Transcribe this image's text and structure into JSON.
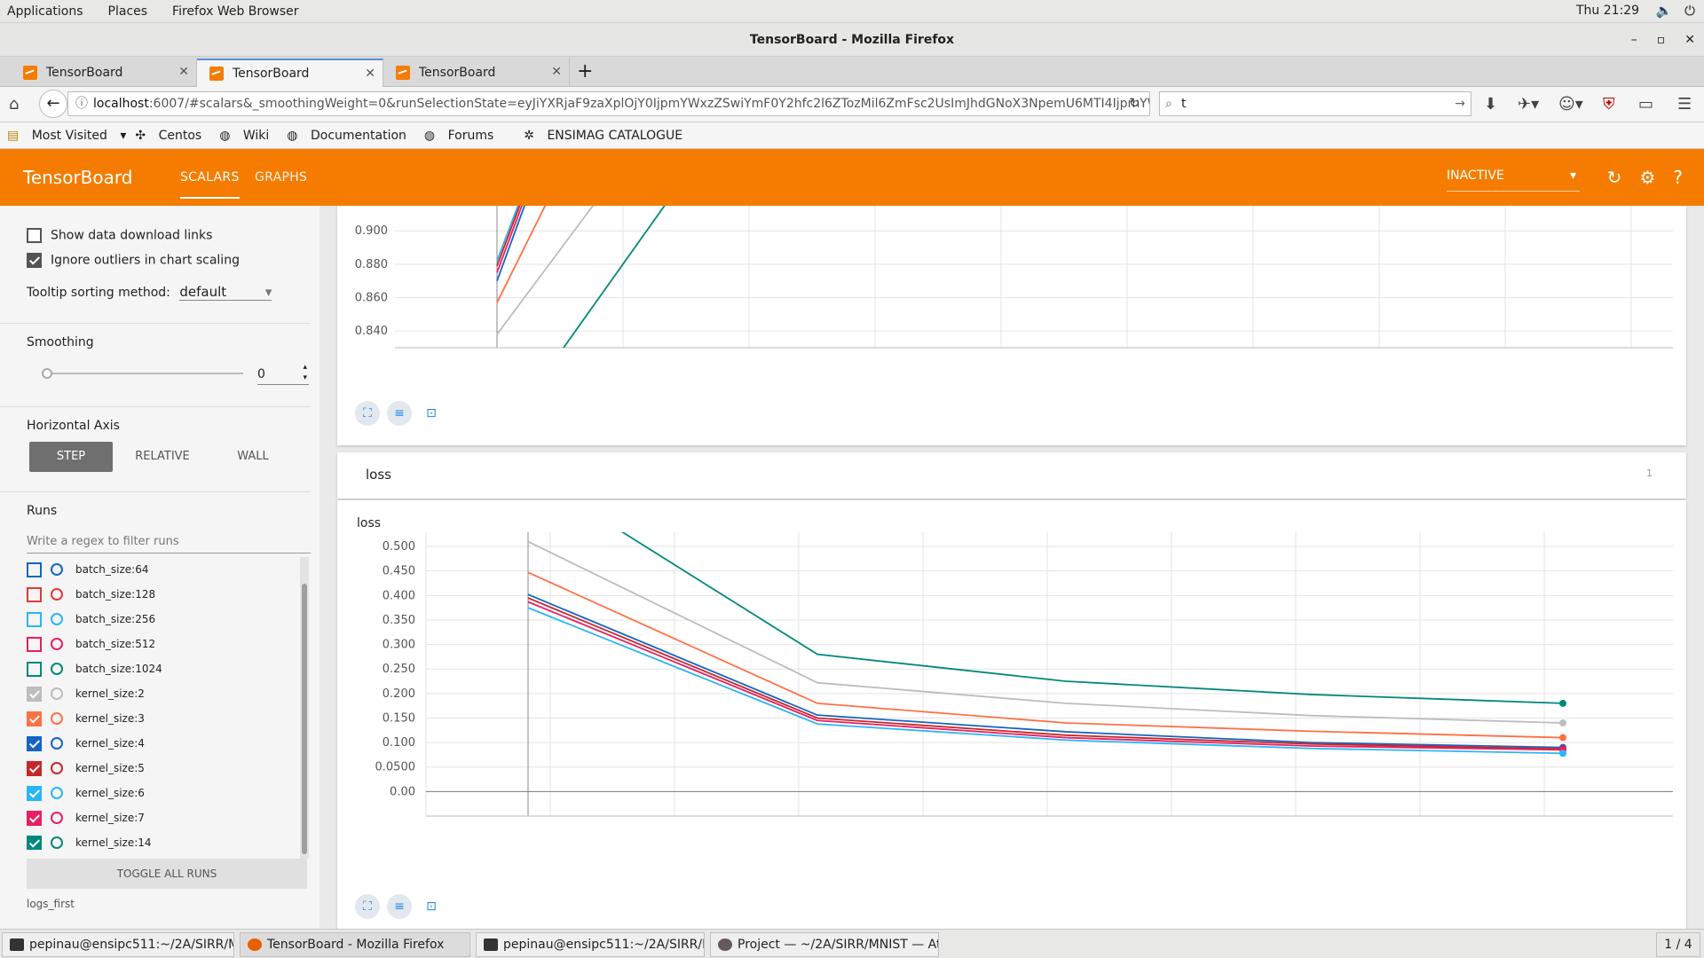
{
  "gnome": {
    "menu": [
      "Applications",
      "Places",
      "Firefox Web Browser"
    ],
    "clock": "Thu 21:29"
  },
  "window": {
    "title": "TensorBoard - Mozilla Firefox"
  },
  "tabs": [
    {
      "label": "TensorBoard"
    },
    {
      "label": "TensorBoard"
    },
    {
      "label": "TensorBoard"
    }
  ],
  "nav": {
    "url_host": "localhost",
    "url_rest": ":6007/#scalars&_smoothingWeight=0&runSelectionState=eyJiYXRjaF9zaXplOjY0IjpmYWxzZSwiYmF0Y2hfc2l6ZTozMil6ZmFsc2UsImJhdGNoX3NpemU6MTI4IjpmYWxzZ",
    "search_value": "t"
  },
  "bookmarks": [
    "Most Visited",
    "Centos",
    "Wiki",
    "Documentation",
    "Forums",
    "ENSIMAG CATALOGUE"
  ],
  "tb": {
    "title": "TensorBoard",
    "tabs": [
      "SCALARS",
      "GRAPHS"
    ],
    "status": "INACTIVE"
  },
  "sidebar": {
    "show_download": "Show data download links",
    "ignore_outliers": "Ignore outliers in chart scaling",
    "tooltip_label": "Tooltip sorting method:",
    "tooltip_value": "default",
    "smoothing_label": "Smoothing",
    "smoothing_value": "0",
    "h_axis_label": "Horizontal Axis",
    "h_axis_options": [
      "STEP",
      "RELATIVE",
      "WALL"
    ],
    "runs_label": "Runs",
    "runs_filter_placeholder": "Write a regex to filter runs",
    "runs": [
      {
        "name": "batch_size:64",
        "color": "#1565c0",
        "checked": false
      },
      {
        "name": "batch_size:128",
        "color": "#e53935",
        "checked": false
      },
      {
        "name": "batch_size:256",
        "color": "#29b6f6",
        "checked": false
      },
      {
        "name": "batch_size:512",
        "color": "#e91e63",
        "checked": false
      },
      {
        "name": "batch_size:1024",
        "color": "#00897b",
        "checked": false
      },
      {
        "name": "kernel_size:2",
        "color": "#bdbdbd",
        "checked": true
      },
      {
        "name": "kernel_size:3",
        "color": "#ff7043",
        "checked": true
      },
      {
        "name": "kernel_size:4",
        "color": "#1565c0",
        "checked": true
      },
      {
        "name": "kernel_size:5",
        "color": "#c62828",
        "checked": true
      },
      {
        "name": "kernel_size:6",
        "color": "#29b6f6",
        "checked": true
      },
      {
        "name": "kernel_size:7",
        "color": "#e91e63",
        "checked": true
      },
      {
        "name": "kernel_size:14",
        "color": "#00897b",
        "checked": true
      }
    ],
    "toggle_all": "TOGGLE ALL RUNS",
    "logdir": "logs_first"
  },
  "main": {
    "section_title": "loss",
    "section_count": "1",
    "chart_title": "loss"
  },
  "chart_data": [
    {
      "type": "line",
      "title": "",
      "y_ticks": [
        "0.900",
        "0.880",
        "0.860",
        "0.840"
      ],
      "ylim": [
        0.83,
        0.915
      ],
      "series": [
        {
          "color": "#29b6f6",
          "x": [
            0,
            1
          ],
          "y": [
            0.882,
            1.2
          ]
        },
        {
          "color": "#c62828",
          "x": [
            0,
            1
          ],
          "y": [
            0.879,
            1.2
          ]
        },
        {
          "color": "#e91e63",
          "x": [
            0,
            1
          ],
          "y": [
            0.875,
            1.2
          ]
        },
        {
          "color": "#1565c0",
          "x": [
            0,
            1
          ],
          "y": [
            0.87,
            1.2
          ]
        },
        {
          "color": "#ff7043",
          "x": [
            0,
            1
          ],
          "y": [
            0.857,
            1.1
          ]
        },
        {
          "color": "#bdbdbd",
          "x": [
            0,
            1
          ],
          "y": [
            0.838,
            1.0
          ]
        },
        {
          "color": "#00897b",
          "x": [
            0,
            1
          ],
          "y": [
            0.78,
            0.95
          ]
        }
      ]
    },
    {
      "type": "line",
      "title": "loss",
      "y_ticks": [
        "0.500",
        "0.450",
        "0.400",
        "0.350",
        "0.300",
        "0.250",
        "0.200",
        "0.150",
        "0.100",
        "0.0500",
        "0.00"
      ],
      "ylim": [
        -0.05,
        0.52
      ],
      "x": [
        0,
        1,
        2,
        3,
        4
      ],
      "series": [
        {
          "color": "#00897b",
          "y": [
            0.65,
            0.28,
            0.225,
            0.198,
            0.18
          ]
        },
        {
          "color": "#bdbdbd",
          "y": [
            0.51,
            0.222,
            0.18,
            0.155,
            0.14
          ]
        },
        {
          "color": "#ff7043",
          "y": [
            0.447,
            0.18,
            0.14,
            0.123,
            0.11
          ]
        },
        {
          "color": "#1565c0",
          "y": [
            0.402,
            0.156,
            0.122,
            0.1,
            0.09
          ]
        },
        {
          "color": "#c62828",
          "y": [
            0.395,
            0.15,
            0.115,
            0.097,
            0.087
          ]
        },
        {
          "color": "#e91e63",
          "y": [
            0.387,
            0.145,
            0.11,
            0.093,
            0.085
          ]
        },
        {
          "color": "#29b6f6",
          "y": [
            0.375,
            0.138,
            0.105,
            0.088,
            0.078
          ]
        }
      ]
    }
  ],
  "taskbar": [
    {
      "label": "pepinau@ensipc511:~/2A/SIRR/MNI..."
    },
    {
      "label": "TensorBoard - Mozilla Firefox"
    },
    {
      "label": "pepinau@ensipc511:~/2A/SIRR/MNI..."
    },
    {
      "label": "Project — ~/2A/SIRR/MNIST — Atom"
    }
  ],
  "workspace": "1 / 4"
}
